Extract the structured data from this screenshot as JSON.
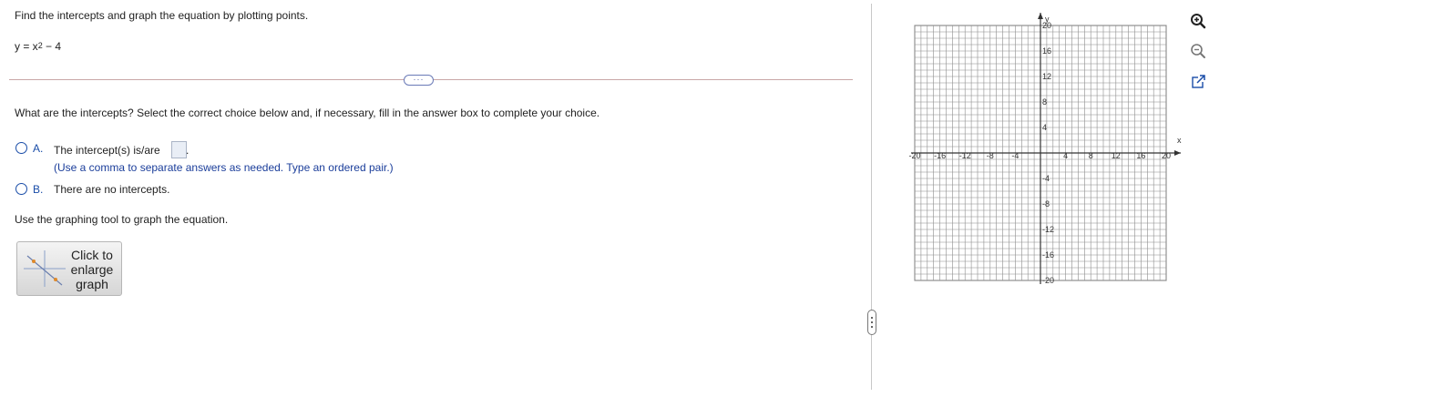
{
  "problem": {
    "prompt": "Find the intercepts and graph the equation by plotting points.",
    "equation_prefix": "y = x",
    "equation_exponent": "2",
    "equation_suffix": " − 4"
  },
  "expand_button": "···",
  "question": "What are the intercepts? Select the correct choice below and, if necessary, fill in the answer box to complete your choice.",
  "choices": [
    {
      "letter": "A.",
      "text": "The intercept(s) is/are",
      "hint": "(Use a comma to separate answers as needed. Type an ordered pair.)",
      "value": ""
    },
    {
      "letter": "B.",
      "text": "There are no intercepts."
    }
  ],
  "graph_instruction": "Use the graphing tool to graph the equation.",
  "graph_button_label": "Click to enlarge graph",
  "graph": {
    "x_label": "x",
    "y_label": "y",
    "xlim": [
      -20,
      20
    ],
    "ylim": [
      -20,
      20
    ],
    "x_tick_labels": [
      "-20",
      "-16",
      "-12",
      "-8",
      "-4",
      "4",
      "8",
      "12",
      "16",
      "20"
    ],
    "y_tick_labels": [
      "20",
      "16",
      "12",
      "8",
      "4",
      "-4",
      "-8",
      "-12",
      "-16",
      "-20"
    ],
    "grid": true,
    "grid_color": "#8d8d8d",
    "axis_color": "#333333"
  },
  "tools": [
    "zoom-in-icon",
    "zoom-out-icon",
    "external-link-icon"
  ],
  "colors": {
    "accent": "#1a4da8",
    "divider": "#c9a6a6"
  }
}
